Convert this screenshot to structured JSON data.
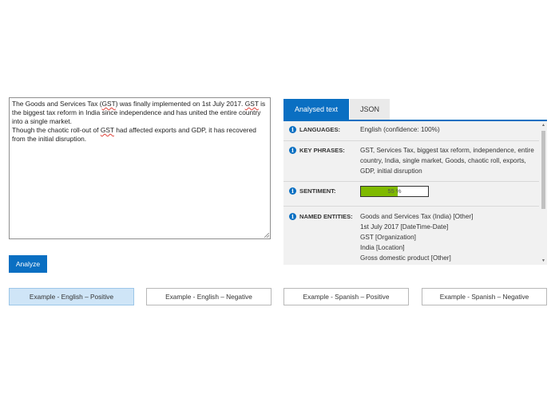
{
  "input": {
    "paragraph1_parts": [
      "The Goods and Services Tax (",
      "GST",
      ") was finally implemented on 1st July 2017. ",
      "GST",
      " is the biggest tax reform in India since independence and has united the entire country into a single market."
    ],
    "paragraph2_parts": [
      "Though the chaotic roll-out of ",
      "GST",
      " had affected exports and GDP, it has recovered from the initial disruption."
    ]
  },
  "analyze_label": "Analyze",
  "tabs": [
    {
      "label": "Analysed text",
      "active": true
    },
    {
      "label": "JSON",
      "active": false
    }
  ],
  "results": {
    "languages": {
      "label": "LANGUAGES:",
      "value": "English (confidence: 100%)"
    },
    "key_phrases": {
      "label": "KEY PHRASES:",
      "value": "GST, Services Tax, biggest tax reform, independence, entire country, India, single market, Goods, chaotic roll, exports, GDP, initial disruption"
    },
    "sentiment": {
      "label": "SENTIMENT:",
      "display": "55 %",
      "fraction": 0.55
    },
    "named_entities": {
      "label": "NAMED ENTITIES:",
      "items": [
        "Goods and Services Tax (India) [Other]",
        "1st July 2017 [DateTime-Date]",
        "GST [Organization]",
        "India [Location]",
        "Gross domestic product [Other]"
      ]
    }
  },
  "examples": [
    {
      "label": "Example - English – Positive",
      "selected": true
    },
    {
      "label": "Example - English – Negative",
      "selected": false
    },
    {
      "label": "Example - Spanish – Positive",
      "selected": false
    },
    {
      "label": "Example - Spanish – Negative",
      "selected": false
    }
  ],
  "colors": {
    "accent": "#0a6fc2",
    "sentiment_fill": "#7fba00",
    "selected_example_bg": "#cfe5f7"
  },
  "icons": [
    "info-icon",
    "resize-grip-icon",
    "scroll-up-arrow-icon",
    "scroll-down-arrow-icon"
  ]
}
